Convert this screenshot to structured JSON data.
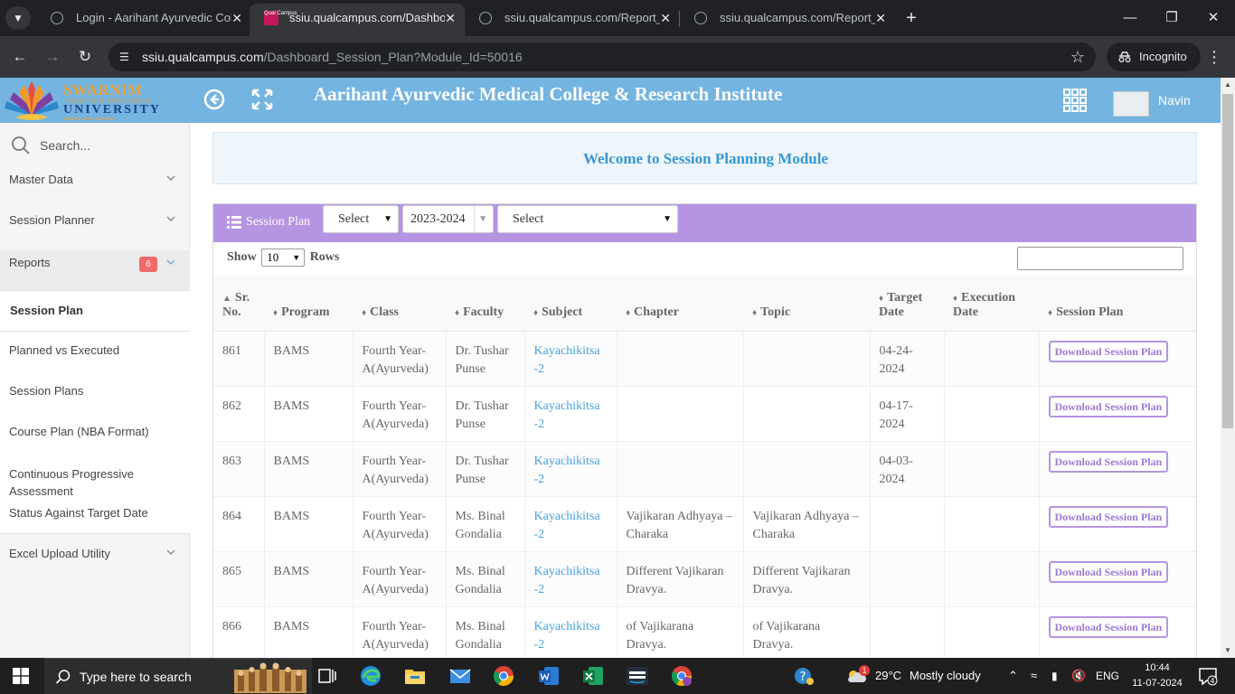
{
  "browser": {
    "tabs": [
      {
        "title": "Login - Aarihant Ayurvedic Colle",
        "icon": "globe-icon",
        "active": false
      },
      {
        "title": "ssiu.qualcampus.com/Dashboar",
        "icon": "qualcampus-icon",
        "active": true
      },
      {
        "title": "ssiu.qualcampus.com/Report_Vi",
        "icon": "globe-icon",
        "active": false
      },
      {
        "title": "ssiu.qualcampus.com/Report_Vi",
        "icon": "globe-icon",
        "active": false
      }
    ],
    "url_host": "ssiu.qualcampus.com",
    "url_path": "/Dashboard_Session_Plan?Module_Id=50016",
    "incognito_label": "Incognito",
    "favicon_text": "Qual Campus"
  },
  "header": {
    "logo_line1": "SWARNIM",
    "logo_line2": "STARTUP & INNOVATION",
    "logo_line3": "UNIVERSITY",
    "logo_line4": "Wisdom Meets Enterprise",
    "college_name": "Aarihant Ayurvedic Medical College & Research Institute",
    "user_name": "Navin",
    "brand_color": "#74b4e0"
  },
  "sidebar": {
    "search_placeholder": "Search...",
    "master_data": "Master Data",
    "session_planner": "Session Planner",
    "reports": "Reports",
    "reports_badge": "6",
    "sub_items": [
      "Session Plan",
      "Planned vs Executed",
      "Session Plans",
      "Course Plan (NBA Format)",
      "Continuous Progressive Assessment",
      "Status Against Target Date"
    ],
    "excel_upload": "Excel Upload Utility"
  },
  "main": {
    "welcome": "Welcome to Session Planning Module",
    "card_title": "Session Plan",
    "filter_1": "Select",
    "filter_year": "2023-2024",
    "filter_3": "Select",
    "show_label": "Show",
    "rows_value": "10",
    "rows_label": "Rows",
    "accent_color": "#b594e2",
    "columns": [
      "Sr. No.",
      "Program",
      "Class",
      "Faculty",
      "Subject",
      "Chapter",
      "Topic",
      "Target Date",
      "Execution Date",
      "Session Plan"
    ],
    "download_label": "Download Session Plan",
    "rows": [
      {
        "sr": "861",
        "program": "BAMS",
        "class": "Fourth Year-A(Ayurveda)",
        "faculty": "Dr. Tushar Punse",
        "subject": "Kayachikitsa -2",
        "chapter": "",
        "topic": "",
        "target": "04-24-2024",
        "execution": ""
      },
      {
        "sr": "862",
        "program": "BAMS",
        "class": "Fourth Year-A(Ayurveda)",
        "faculty": "Dr. Tushar Punse",
        "subject": "Kayachikitsa -2",
        "chapter": "",
        "topic": "",
        "target": "04-17-2024",
        "execution": ""
      },
      {
        "sr": "863",
        "program": "BAMS",
        "class": "Fourth Year-A(Ayurveda)",
        "faculty": "Dr. Tushar Punse",
        "subject": "Kayachikitsa -2",
        "chapter": "",
        "topic": "",
        "target": "04-03-2024",
        "execution": ""
      },
      {
        "sr": "864",
        "program": "BAMS",
        "class": "Fourth Year-A(Ayurveda)",
        "faculty": "Ms. Binal Gondalia",
        "subject": "Kayachikitsa -2",
        "chapter": "Vajikaran Adhyaya – Charaka",
        "topic": "Vajikaran Adhyaya – Charaka",
        "target": "",
        "execution": ""
      },
      {
        "sr": "865",
        "program": "BAMS",
        "class": "Fourth Year-A(Ayurveda)",
        "faculty": "Ms. Binal Gondalia",
        "subject": "Kayachikitsa -2",
        "chapter": "Different Vajikaran Dravya.",
        "topic": "Different Vajikaran Dravya.",
        "target": "",
        "execution": ""
      },
      {
        "sr": "866",
        "program": "BAMS",
        "class": "Fourth Year-A(Ayurveda)",
        "faculty": "Ms. Binal Gondalia",
        "subject": "Kayachikitsa -2",
        "chapter": "of Vajikarana Dravya.",
        "topic": "of Vajikarana Dravya.",
        "target": "",
        "execution": ""
      }
    ]
  },
  "taskbar": {
    "search_text": "Type here to search",
    "temperature": "29°C",
    "weather": "Mostly cloudy",
    "weather_badge": "1",
    "language": "ENG",
    "time": "10:44",
    "date": "11-07-2024",
    "notif_count": "4"
  }
}
